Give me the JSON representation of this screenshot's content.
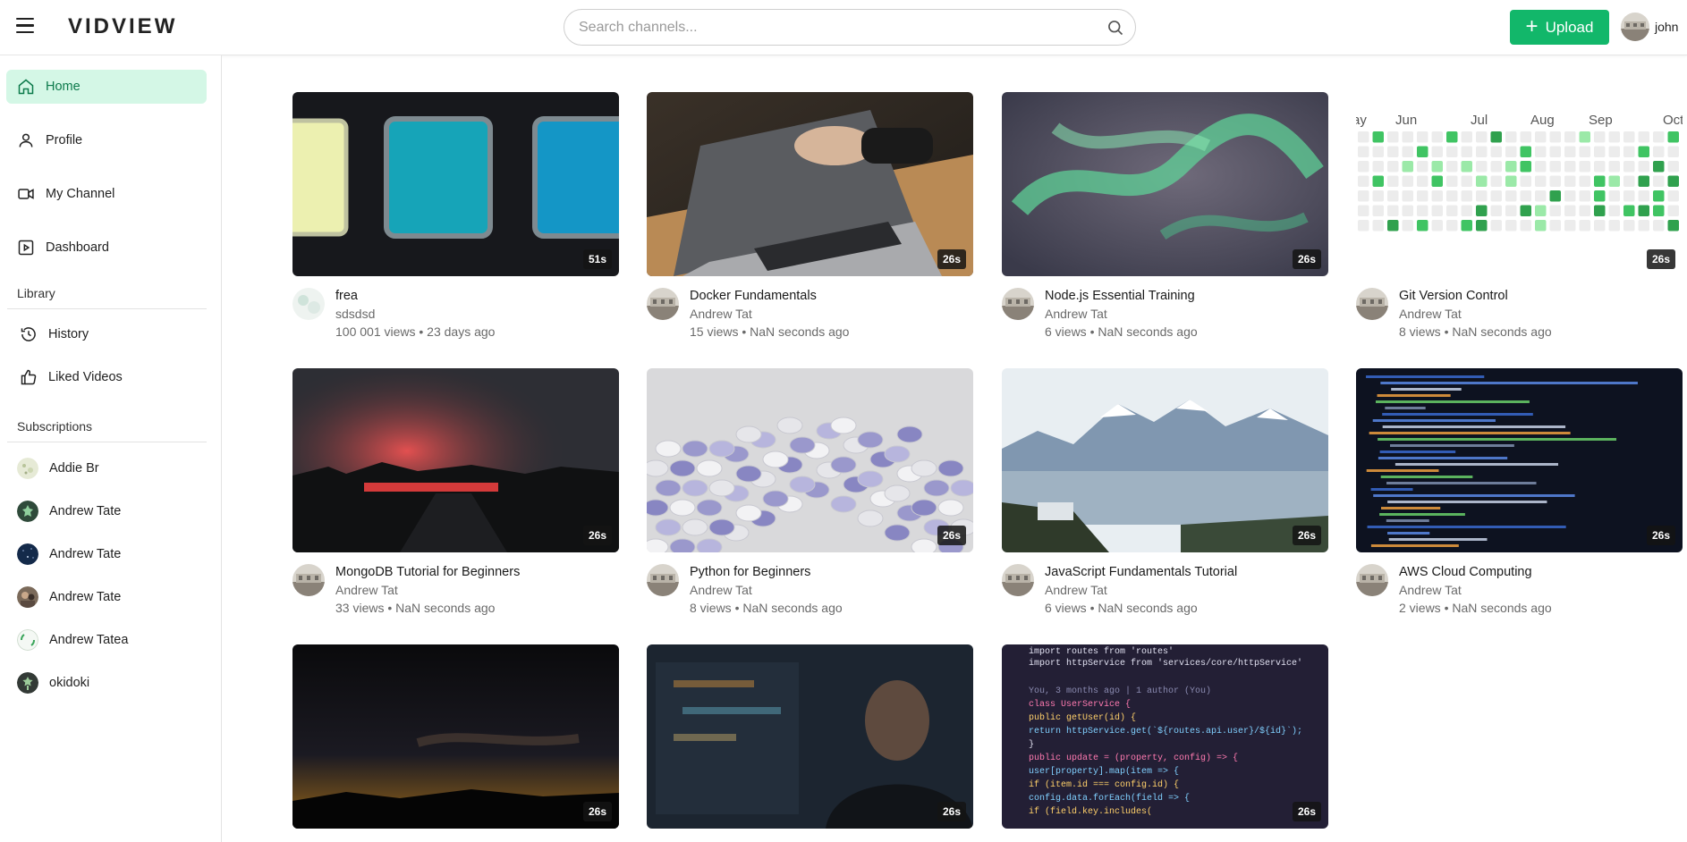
{
  "header": {
    "logo": "VIDVIEW",
    "search_placeholder": "Search channels...",
    "upload_label": "Upload",
    "user_name": "john",
    "accent": "#12b76a"
  },
  "sidebar": {
    "nav": [
      {
        "label": "Home",
        "icon": "home-icon",
        "active": true
      },
      {
        "label": "Profile",
        "icon": "user-icon"
      },
      {
        "label": "My Channel",
        "icon": "video-camera-icon"
      },
      {
        "label": "Dashboard",
        "icon": "play-square-icon"
      }
    ],
    "library_title": "Library",
    "library": [
      {
        "label": "History",
        "icon": "history-icon"
      },
      {
        "label": "Liked Videos",
        "icon": "thumbs-up-icon"
      }
    ],
    "subscriptions_title": "Subscriptions",
    "subscriptions": [
      {
        "label": "Addie Br"
      },
      {
        "label": "Andrew Tate"
      },
      {
        "label": "Andrew Tate"
      },
      {
        "label": "Andrew Tate"
      },
      {
        "label": "Andrew Tatea"
      },
      {
        "label": "okidoki"
      }
    ]
  },
  "videos": [
    {
      "title": "frea",
      "channel": "sdsdsd",
      "stats": "100 001 views • 23 days ago",
      "duration": "51s"
    },
    {
      "title": "Docker Fundamentals",
      "channel": "Andrew Tat",
      "stats": "15 views • NaN seconds ago",
      "duration": "26s"
    },
    {
      "title": "Node.js Essential Training",
      "channel": "Andrew Tat",
      "stats": "6 views • NaN seconds ago",
      "duration": "26s"
    },
    {
      "title": "Git Version Control",
      "channel": "Andrew Tat",
      "stats": "8 views • NaN seconds ago",
      "duration": "26s"
    },
    {
      "title": "MongoDB Tutorial for Beginners",
      "channel": "Andrew Tat",
      "stats": "33 views • NaN seconds ago",
      "duration": "26s"
    },
    {
      "title": "Python for Beginners",
      "channel": "Andrew Tat",
      "stats": "8 views • NaN seconds ago",
      "duration": "26s"
    },
    {
      "title": "JavaScript Fundamentals Tutorial",
      "channel": "Andrew Tat",
      "stats": "6 views • NaN seconds ago",
      "duration": "26s"
    },
    {
      "title": "AWS Cloud Computing",
      "channel": "Andrew Tat",
      "stats": "2 views • NaN seconds ago",
      "duration": "26s"
    },
    {
      "duration": "26s"
    },
    {
      "duration": "26s"
    },
    {
      "duration": "26s"
    }
  ],
  "thumb_text": {
    "months": [
      "Jun",
      "Jul",
      "Aug",
      "Sep",
      "Oct"
    ],
    "month_fragment": "ay",
    "code_lines": [
      "import routes from 'routes'",
      "import httpService from 'services/core/httpService'",
      "You, 3 months ago | 1 author (You)",
      "class UserService {",
      "  public getUser(id) {",
      "    return httpService.get(`${routes.api.user}/${id}`);",
      "  }",
      "  public update = (property, config) => {",
      "    user[property].map(item => {",
      "      if (item.id === config.id) {",
      "        config.data.forEach(field => {",
      "          if (field.key.includes("
    ]
  }
}
